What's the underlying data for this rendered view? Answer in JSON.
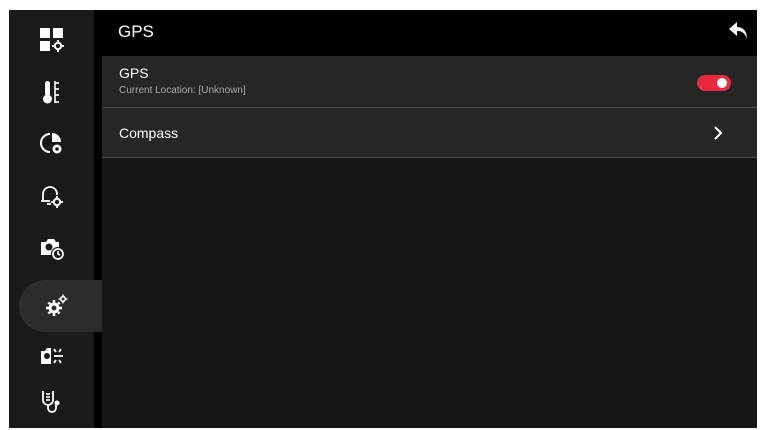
{
  "header": {
    "title": "GPS"
  },
  "sidebar": {
    "items": [
      {
        "icon": "dashboard-settings-icon",
        "active": false
      },
      {
        "icon": "thermometer-icon",
        "active": false
      },
      {
        "icon": "pie-chart-settings-icon",
        "active": false
      },
      {
        "icon": "bell-settings-icon",
        "active": false
      },
      {
        "icon": "camera-timer-icon",
        "active": false
      },
      {
        "icon": "gears-icon",
        "active": true
      },
      {
        "icon": "camera-scan-icon",
        "active": false
      },
      {
        "icon": "stethoscope-icon",
        "active": false
      }
    ]
  },
  "settings": {
    "gps": {
      "title": "GPS",
      "subtitle": "Current Location: [Unknown]",
      "enabled": true
    },
    "compass": {
      "title": "Compass"
    }
  },
  "colors": {
    "accent": "#e8293e",
    "background": "#000000",
    "sidebar": "#1a1a1a",
    "row": "#262626",
    "content": "#161616"
  }
}
